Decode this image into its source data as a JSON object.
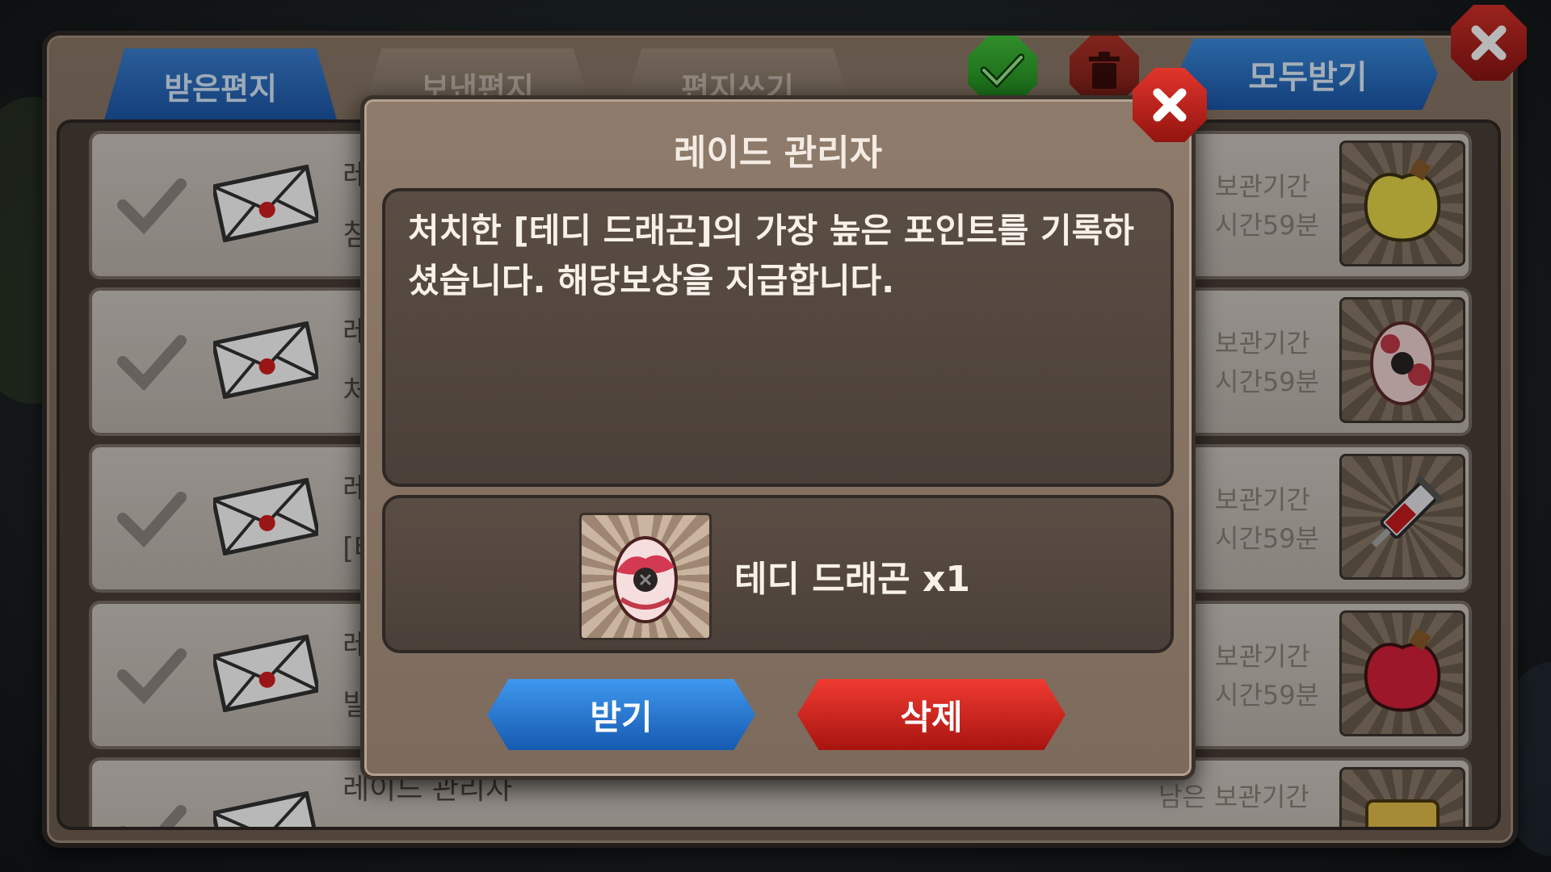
{
  "tabs": {
    "received": "받은편지",
    "sent": "보낸편지",
    "write": "편지쓰기"
  },
  "toolbar": {
    "receive_all": "모두받기",
    "check_all_icon": "check-icon",
    "trash_icon": "trash-icon",
    "close_icon": "close-icon"
  },
  "mail_rows": [
    {
      "sender": "레",
      "subject": "침",
      "expire_label": "보관기간",
      "expire_value": "시간59분",
      "item": "yellow-potion"
    },
    {
      "sender": "레",
      "subject": "처",
      "expire_label": "보관기간",
      "expire_value": "시간59분",
      "item": "dragon-egg"
    },
    {
      "sender": "레",
      "subject": "[테",
      "expire_label": "보관기간",
      "expire_value": "시간59분",
      "item": "syringe"
    },
    {
      "sender": "레",
      "subject": "빌",
      "expire_label": "보관기간",
      "expire_value": "시간59분",
      "item": "red-potion"
    },
    {
      "sender": "레이드 관리자",
      "subject": "",
      "expire_label": "남은 보관기간",
      "expire_value": "",
      "item": "scroll"
    }
  ],
  "modal": {
    "title": "레이드 관리자",
    "message": "처치한 [테디 드래곤]의 가장 높은 포인트를 기록하셨습니다. 해당보상을 지급합니다.",
    "reward_label": "테디 드래곤 x1",
    "receive_button": "받기",
    "delete_button": "삭제"
  },
  "colors": {
    "blue_button": "#1b6fd0",
    "red_button": "#d4211b",
    "panel_brown": "#7c6a5c"
  }
}
